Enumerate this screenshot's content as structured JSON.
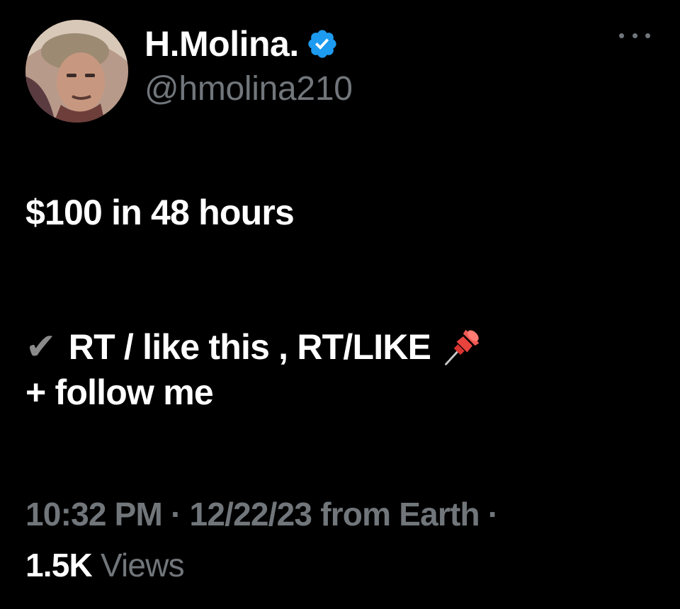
{
  "user": {
    "display_name": "H.Molina.",
    "handle": "@hmolina210",
    "verified": true
  },
  "tweet": {
    "line1": "$100 in 48 hours",
    "line2": "RT / like this , RT/LIKE",
    "line3": "+ follow me"
  },
  "meta": {
    "time": "10:32 PM",
    "date": "12/22/23",
    "source": "from Earth",
    "separator": "·",
    "views_count": "1.5K",
    "views_label": "Views"
  },
  "icons": {
    "check": "✔",
    "verified": "verified-badge-icon",
    "pin": "pushpin-icon",
    "more": "more-options-icon"
  },
  "colors": {
    "background": "#000000",
    "primary_text": "#ffffff",
    "secondary_text": "#71767b",
    "verified_blue": "#1d9bf0"
  }
}
